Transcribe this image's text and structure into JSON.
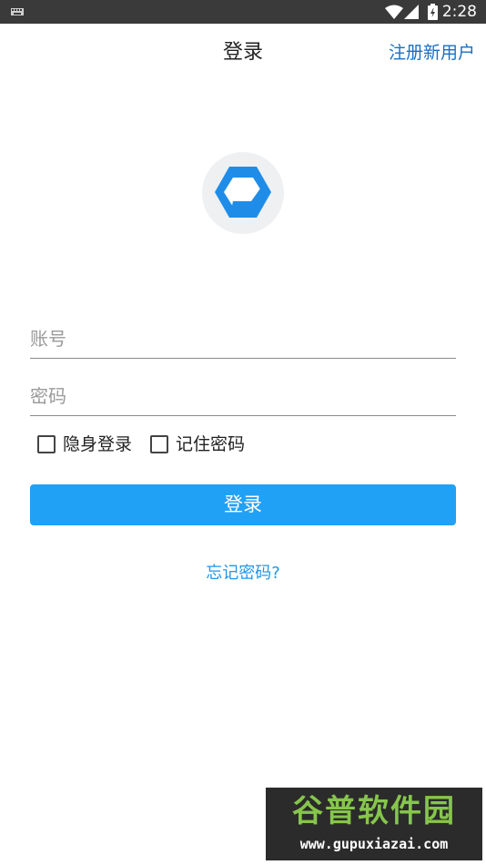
{
  "status_bar": {
    "time": "2:28",
    "icons": [
      "keyboard-icon",
      "wifi-icon",
      "signal-icon",
      "battery-icon"
    ]
  },
  "header": {
    "title": "登录",
    "register_link": "注册新用户"
  },
  "logo": {
    "icon": "app-logo-icon"
  },
  "form": {
    "account_placeholder": "账号",
    "password_placeholder": "密码",
    "stealth_login_label": "隐身登录",
    "remember_password_label": "记住密码",
    "login_button": "登录",
    "forgot_password": "忘记密码?"
  },
  "watermark": {
    "title": "谷普软件园",
    "url": "www.gupuxiazai.com"
  },
  "colors": {
    "status_bar": "#3a3a3a",
    "link_blue": "#1a6fc4",
    "button_blue": "#21a1f5",
    "logo_blue": "#1f8de8"
  }
}
